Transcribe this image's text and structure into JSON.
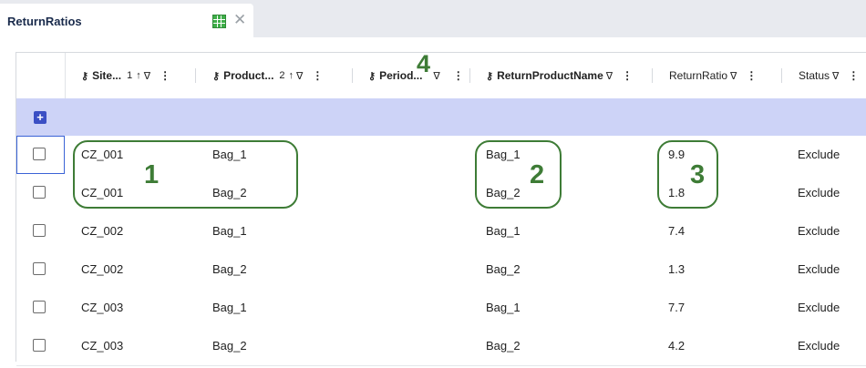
{
  "tab": {
    "title": "ReturnRatios",
    "grid_icon": "grid-icon",
    "close": "✕"
  },
  "columns": [
    {
      "key": true,
      "name": "Site...",
      "order": "1",
      "sort": "↑",
      "filter": "∇",
      "more": "⋮"
    },
    {
      "key": true,
      "name": "Product...",
      "order": "2",
      "sort": "↑",
      "filter": "∇",
      "more": "⋮"
    },
    {
      "key": true,
      "name": "Period...",
      "filter": "∇",
      "more": "⋮"
    },
    {
      "key": true,
      "name": "ReturnProductName",
      "filter": "∇",
      "more": "⋮"
    },
    {
      "key": false,
      "name": "ReturnRatio",
      "filter": "∇",
      "more": "⋮"
    },
    {
      "key": false,
      "name": "Status",
      "filter": "∇",
      "more": "⋮"
    }
  ],
  "key_icon": "🔑",
  "add_button": "+",
  "rows": [
    {
      "site": "CZ_001",
      "product": "Bag_1",
      "return_product": "Bag_1",
      "ratio": "9.9",
      "status": "Exclude"
    },
    {
      "site": "CZ_001",
      "product": "Bag_2",
      "return_product": "Bag_2",
      "ratio": "1.8",
      "status": "Exclude"
    },
    {
      "site": "CZ_002",
      "product": "Bag_1",
      "return_product": "Bag_1",
      "ratio": "7.4",
      "status": "Exclude"
    },
    {
      "site": "CZ_002",
      "product": "Bag_2",
      "return_product": "Bag_2",
      "ratio": "1.3",
      "status": "Exclude"
    },
    {
      "site": "CZ_003",
      "product": "Bag_1",
      "return_product": "Bag_1",
      "ratio": "7.7",
      "status": "Exclude"
    },
    {
      "site": "CZ_003",
      "product": "Bag_2",
      "return_product": "Bag_2",
      "ratio": "4.2",
      "status": "Exclude"
    }
  ],
  "annotations": [
    "1",
    "2",
    "3",
    "4"
  ],
  "colors": {
    "annotation": "#3e7c36",
    "add_row_bg": "#cdd3f7",
    "add_button": "#3b4fc4"
  }
}
